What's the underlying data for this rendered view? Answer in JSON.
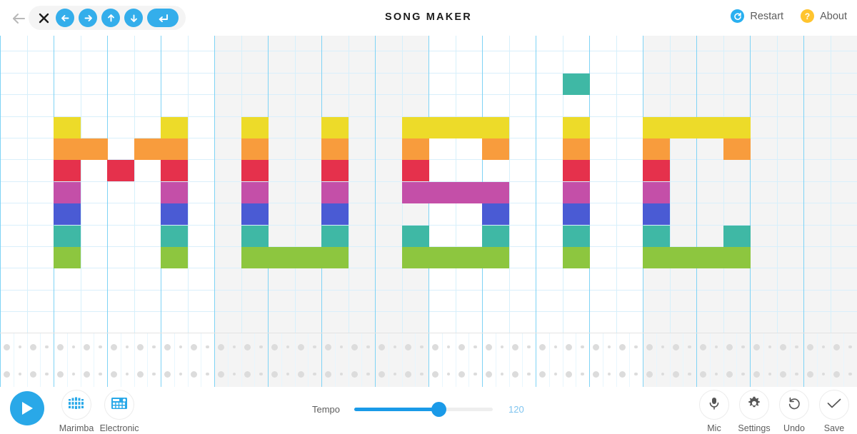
{
  "header": {
    "title": "SONG MAKER",
    "back_icon": "back-arrow-icon",
    "nav_pill": {
      "close_label": "✕",
      "buttons": [
        {
          "name": "arrow-left-button",
          "glyph": "←"
        },
        {
          "name": "arrow-right-button",
          "glyph": "→"
        },
        {
          "name": "arrow-up-button",
          "glyph": "↑"
        },
        {
          "name": "arrow-down-button",
          "glyph": "↓"
        },
        {
          "name": "enter-button",
          "glyph": "↵"
        }
      ]
    },
    "restart_label": "Restart",
    "restart_icon_glyph": "↺",
    "about_label": "About",
    "about_icon_glyph": "?"
  },
  "colors": {
    "row_colors": [
      "#eddb29",
      "#f89c3d",
      "#e5314c",
      "#c44fa8",
      "#4a5bd4",
      "#3fb8a5",
      "#8dc63f"
    ],
    "accent": "#29a8e8",
    "grid_line_beat": "#7fd3f5",
    "grid_line_half": "#d6f0fb",
    "bar_shade": "#f4f4f4",
    "restart_icon": "#29b0f0",
    "about_icon": "#ffc42e",
    "tempo_fill": "#1a9ae8"
  },
  "grid": {
    "columns": 32,
    "rows": 14,
    "col_width": 37.5,
    "row_height": 30.4,
    "visible_rows": 7,
    "visible_row_start": 4,
    "bars": 4,
    "shaded_bars": [
      1,
      3
    ],
    "notes": [
      {
        "col": 2,
        "row": 4
      },
      {
        "col": 2,
        "row": 5
      },
      {
        "col": 2,
        "row": 6
      },
      {
        "col": 2,
        "row": 7
      },
      {
        "col": 2,
        "row": 8
      },
      {
        "col": 2,
        "row": 9
      },
      {
        "col": 2,
        "row": 10
      },
      {
        "col": 3,
        "row": 5
      },
      {
        "col": 4,
        "row": 6
      },
      {
        "col": 5,
        "row": 5
      },
      {
        "col": 6,
        "row": 4
      },
      {
        "col": 6,
        "row": 5
      },
      {
        "col": 6,
        "row": 6
      },
      {
        "col": 6,
        "row": 7
      },
      {
        "col": 6,
        "row": 8
      },
      {
        "col": 6,
        "row": 9
      },
      {
        "col": 6,
        "row": 10
      },
      {
        "col": 9,
        "row": 4
      },
      {
        "col": 9,
        "row": 5
      },
      {
        "col": 9,
        "row": 6
      },
      {
        "col": 9,
        "row": 7
      },
      {
        "col": 9,
        "row": 8
      },
      {
        "col": 9,
        "row": 9
      },
      {
        "col": 9,
        "row": 10
      },
      {
        "col": 10,
        "row": 10
      },
      {
        "col": 11,
        "row": 10
      },
      {
        "col": 12,
        "row": 4
      },
      {
        "col": 12,
        "row": 5
      },
      {
        "col": 12,
        "row": 6
      },
      {
        "col": 12,
        "row": 7
      },
      {
        "col": 12,
        "row": 8
      },
      {
        "col": 12,
        "row": 9
      },
      {
        "col": 12,
        "row": 10
      },
      {
        "col": 15,
        "row": 4
      },
      {
        "col": 15,
        "row": 5
      },
      {
        "col": 15,
        "row": 6
      },
      {
        "col": 15,
        "row": 7
      },
      {
        "col": 15,
        "row": 9
      },
      {
        "col": 15,
        "row": 10
      },
      {
        "col": 16,
        "row": 4
      },
      {
        "col": 16,
        "row": 7
      },
      {
        "col": 16,
        "row": 10
      },
      {
        "col": 17,
        "row": 4
      },
      {
        "col": 17,
        "row": 7
      },
      {
        "col": 17,
        "row": 10
      },
      {
        "col": 18,
        "row": 4
      },
      {
        "col": 18,
        "row": 5
      },
      {
        "col": 18,
        "row": 7
      },
      {
        "col": 18,
        "row": 8
      },
      {
        "col": 18,
        "row": 9
      },
      {
        "col": 18,
        "row": 10
      },
      {
        "col": 21,
        "row": 2
      },
      {
        "col": 21,
        "row": 4
      },
      {
        "col": 21,
        "row": 5
      },
      {
        "col": 21,
        "row": 6
      },
      {
        "col": 21,
        "row": 7
      },
      {
        "col": 21,
        "row": 8
      },
      {
        "col": 21,
        "row": 9
      },
      {
        "col": 21,
        "row": 10
      },
      {
        "col": 24,
        "row": 4
      },
      {
        "col": 24,
        "row": 5
      },
      {
        "col": 24,
        "row": 6
      },
      {
        "col": 24,
        "row": 7
      },
      {
        "col": 24,
        "row": 8
      },
      {
        "col": 24,
        "row": 9
      },
      {
        "col": 24,
        "row": 10
      },
      {
        "col": 25,
        "row": 4
      },
      {
        "col": 25,
        "row": 10
      },
      {
        "col": 26,
        "row": 4
      },
      {
        "col": 26,
        "row": 10
      },
      {
        "col": 27,
        "row": 4
      },
      {
        "col": 27,
        "row": 5
      },
      {
        "col": 27,
        "row": 9
      },
      {
        "col": 27,
        "row": 10
      }
    ]
  },
  "percussion": {
    "rows": 2,
    "columns": 64,
    "dots": []
  },
  "transport": {
    "play_label": "play-button",
    "instruments": [
      {
        "name": "marimba",
        "label": "Marimba",
        "icon": "marimba-icon"
      },
      {
        "name": "electronic",
        "label": "Electronic",
        "icon": "drum-machine-icon"
      }
    ]
  },
  "tempo": {
    "label": "Tempo",
    "value": "120",
    "min": 40,
    "max": 240,
    "percent": 61
  },
  "tools": [
    {
      "name": "mic",
      "label": "Mic",
      "icon": "microphone-icon"
    },
    {
      "name": "settings",
      "label": "Settings",
      "icon": "gear-icon"
    },
    {
      "name": "undo",
      "label": "Undo",
      "icon": "undo-icon"
    },
    {
      "name": "save",
      "label": "Save",
      "icon": "check-icon"
    }
  ]
}
